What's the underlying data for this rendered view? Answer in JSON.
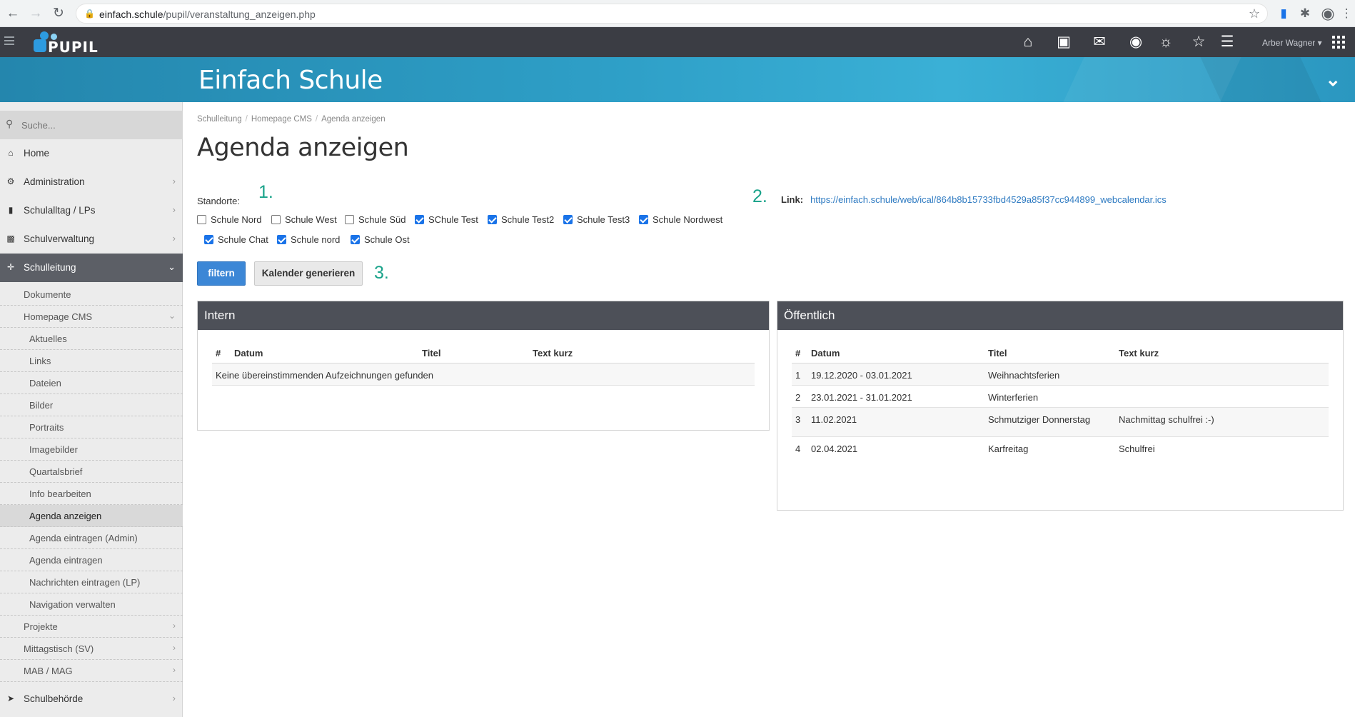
{
  "browser": {
    "url_domain": "einfach.schule",
    "url_path": "/pupil/veranstaltung_anzeigen.php"
  },
  "topbar": {
    "brand": "PUPIL",
    "user": "Arber Wagner",
    "icons": [
      "home-icon",
      "office-icon",
      "outlook-icon",
      "chat-icon",
      "lightbulb-icon",
      "star-icon",
      "sliders-icon"
    ]
  },
  "banner": {
    "title": "Einfach Schule"
  },
  "sidebar": {
    "search_placeholder": "Suche...",
    "items": [
      {
        "label": "Home"
      },
      {
        "label": "Administration"
      },
      {
        "label": "Schulalltag / LPs"
      },
      {
        "label": "Schulverwaltung"
      },
      {
        "label": "Schulleitung"
      }
    ],
    "sub1": [
      {
        "label": "Dokumente"
      },
      {
        "label": "Homepage CMS"
      }
    ],
    "sub2": [
      {
        "label": "Aktuelles"
      },
      {
        "label": "Links"
      },
      {
        "label": "Dateien"
      },
      {
        "label": "Bilder"
      },
      {
        "label": "Portraits"
      },
      {
        "label": "Imagebilder"
      },
      {
        "label": "Quartalsbrief"
      },
      {
        "label": "Info bearbeiten"
      },
      {
        "label": "Agenda anzeigen"
      },
      {
        "label": "Agenda eintragen (Admin)"
      },
      {
        "label": "Agenda eintragen"
      },
      {
        "label": "Nachrichten eintragen (LP)"
      },
      {
        "label": "Navigation verwalten"
      }
    ],
    "sub3": [
      {
        "label": "Projekte"
      },
      {
        "label": "Mittagstisch (SV)"
      },
      {
        "label": "MAB / MAG"
      }
    ],
    "bottom": {
      "label": "Schulbehörde"
    }
  },
  "breadcrumb": [
    "Schulleitung",
    "Homepage CMS",
    "Agenda anzeigen"
  ],
  "page_title": "Agenda anzeigen",
  "standorte_label": "Standorte:",
  "annotations": {
    "n1": "1.",
    "n2": "2.",
    "n3": "3."
  },
  "link": {
    "label": "Link:",
    "url": "https://einfach.schule/web/ical/864b8b15733fbd4529a85f37cc944899_webcalendar.ics"
  },
  "locations": [
    {
      "label": "Schule Nord",
      "checked": false
    },
    {
      "label": "Schule West",
      "checked": false
    },
    {
      "label": "Schule Süd",
      "checked": false
    },
    {
      "label": "SChule Test",
      "checked": true
    },
    {
      "label": "Schule Test2",
      "checked": true
    },
    {
      "label": "Schule Test3",
      "checked": true
    },
    {
      "label": "Schule Nordwest",
      "checked": true
    },
    {
      "label": "Schule Chat",
      "checked": true
    },
    {
      "label": "Schule nord",
      "checked": true
    },
    {
      "label": "Schule Ost",
      "checked": true
    }
  ],
  "buttons": {
    "filter": "filtern",
    "generate": "Kalender generieren"
  },
  "intern": {
    "title": "Intern",
    "columns": [
      "#",
      "Datum",
      "Titel",
      "Text kurz"
    ],
    "empty": "Keine übereinstimmenden Aufzeichnungen gefunden"
  },
  "public": {
    "title": "Öffentlich",
    "columns": [
      "#",
      "Datum",
      "Titel",
      "Text kurz"
    ],
    "rows": [
      {
        "n": "1",
        "datum": "19.12.2020 - 03.01.2021",
        "titel": "Weihnachtsferien",
        "text": ""
      },
      {
        "n": "2",
        "datum": "23.01.2021 - 31.01.2021",
        "titel": "Winterferien",
        "text": ""
      },
      {
        "n": "3",
        "datum": "11.02.2021",
        "titel": "Schmutziger Donnerstag",
        "text": "Nachmittag schulfrei :-)"
      },
      {
        "n": "4",
        "datum": "02.04.2021",
        "titel": "Karfreitag",
        "text": "Schulfrei"
      }
    ]
  }
}
